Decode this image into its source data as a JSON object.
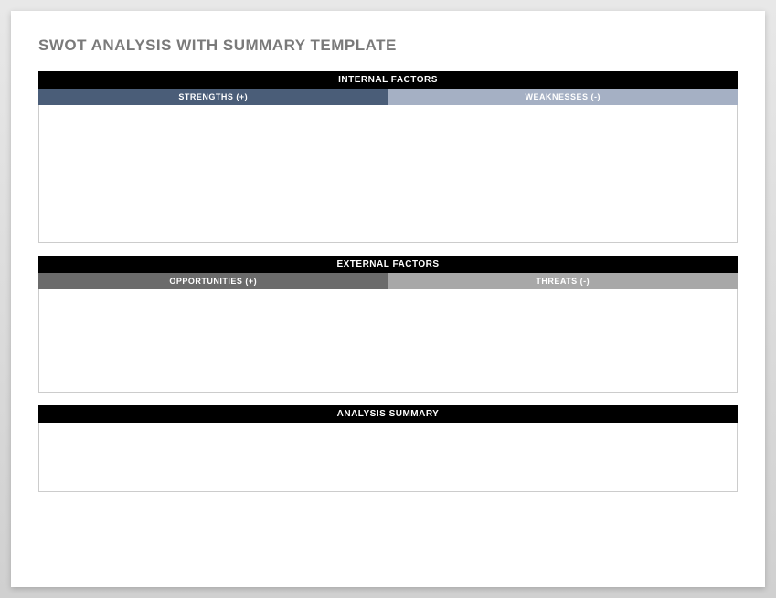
{
  "title": "SWOT ANALYSIS WITH SUMMARY TEMPLATE",
  "sections": {
    "internal": {
      "header": "INTERNAL FACTORS",
      "left": "STRENGTHS (+)",
      "right": "WEAKNESSES (-)"
    },
    "external": {
      "header": "EXTERNAL FACTORS",
      "left": "OPPORTUNITIES (+)",
      "right": "THREATS (-)"
    },
    "summary": {
      "header": "ANALYSIS SUMMARY"
    }
  }
}
